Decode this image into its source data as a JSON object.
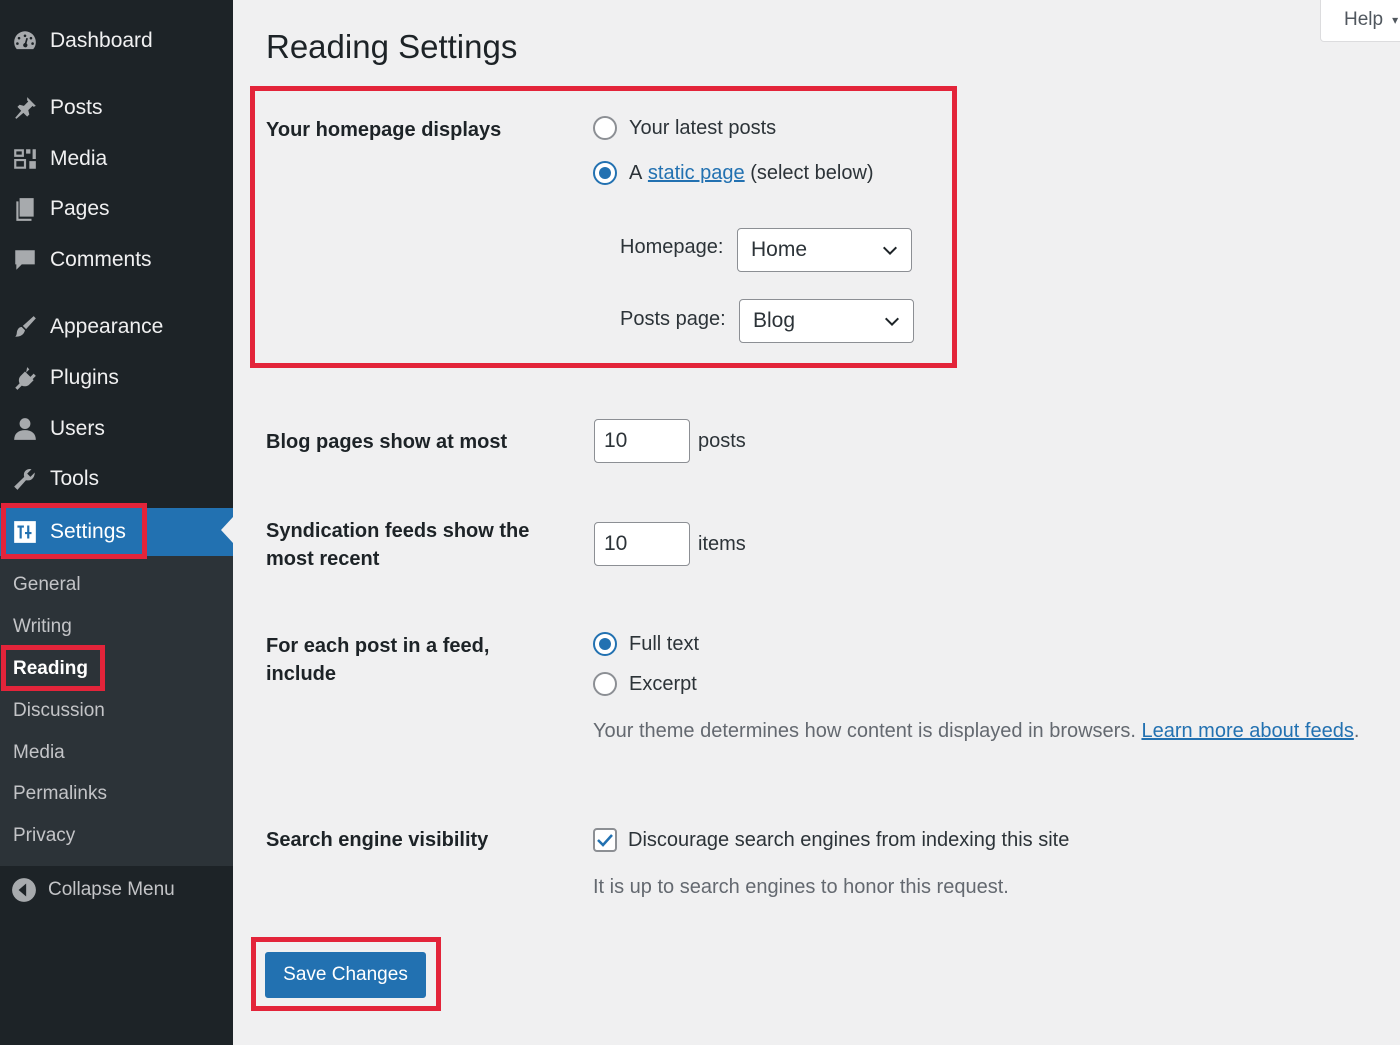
{
  "sidebar": {
    "menu": [
      {
        "label": "Dashboard",
        "icon": "dashboard-icon"
      },
      {
        "label": "Posts",
        "icon": "pin-icon"
      },
      {
        "label": "Media",
        "icon": "media-icon"
      },
      {
        "label": "Pages",
        "icon": "pages-icon"
      },
      {
        "label": "Comments",
        "icon": "comment-icon"
      },
      {
        "label": "Appearance",
        "icon": "brush-icon"
      },
      {
        "label": "Plugins",
        "icon": "plug-icon"
      },
      {
        "label": "Users",
        "icon": "user-icon"
      },
      {
        "label": "Tools",
        "icon": "wrench-icon"
      },
      {
        "label": "Settings",
        "icon": "settings-icon"
      }
    ],
    "submenu": [
      "General",
      "Writing",
      "Reading",
      "Discussion",
      "Media",
      "Permalinks",
      "Privacy"
    ],
    "current_submenu": "Reading",
    "collapse_label": "Collapse Menu"
  },
  "help": {
    "label": "Help"
  },
  "page": {
    "title": "Reading Settings"
  },
  "homepage": {
    "label": "Your homepage displays",
    "option_latest": "Your latest posts",
    "option_static_prefix": "A",
    "option_static_link": "static page",
    "option_static_suffix": "(select below)",
    "selected": "static",
    "homepage_label": "Homepage:",
    "homepage_value": "Home",
    "posts_page_label": "Posts page:",
    "posts_page_value": "Blog"
  },
  "blog_pages": {
    "label": "Blog pages show at most",
    "value": "10",
    "unit": "posts"
  },
  "syndication": {
    "label": "Syndication feeds show the most recent",
    "value": "10",
    "unit": "items"
  },
  "feed_content": {
    "label": "For each post in a feed, include",
    "option_full": "Full text",
    "option_excerpt": "Excerpt",
    "selected": "full",
    "desc": "Your theme determines how content is displayed in browsers.",
    "link": "Learn more about feeds",
    "desc_end": "."
  },
  "search_visibility": {
    "label": "Search engine visibility",
    "checkbox_label": "Discourage search engines from indexing this site",
    "checked": true,
    "desc": "It is up to search engines to honor this request."
  },
  "save": {
    "label": "Save Changes"
  },
  "colors": {
    "admin_bg": "#1d2327",
    "accent": "#2271b1",
    "highlight": "#e3243a",
    "page_bg": "#f0f0f1"
  }
}
